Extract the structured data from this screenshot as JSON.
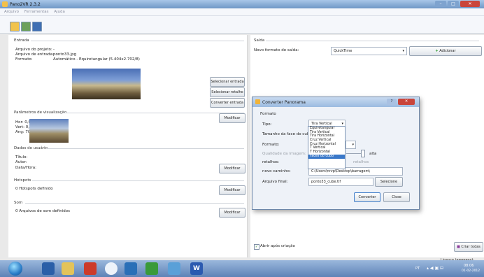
{
  "window": {
    "title": "Pano2VR 2.3.2"
  },
  "menu": [
    "Arquivo",
    "Ferramentas",
    "Ajuda"
  ],
  "left": {
    "entrada": {
      "title": "Entrada",
      "projeto_label": "Arquivo do projeto:",
      "projeto_value": "-",
      "entrada_label": "Arquivo de entrada:",
      "entrada_value": "ponto33.jpg",
      "formato_label": "Formato:",
      "formato_value": "Automático - Equiretangular (5.404x2.702/8)",
      "btn_selecionar_entrada": "Selecionar entrada",
      "btn_selecionar_retalho": "Selecionar retalho",
      "btn_converter_entrada": "Converter entrada"
    },
    "params": {
      "title": "Parâmetros de visualização",
      "hor": "Hor:  0,0",
      "vert": "Vert:  0,0",
      "ang": "Ang:  70,0",
      "btn_modificar": "Modificar"
    },
    "dados": {
      "title": "Dados do usuário",
      "titulo": "Título:",
      "autor": "Autor:",
      "data": "Data/Hora:",
      "btn_modificar": "Modificar"
    },
    "hotspots": {
      "title": "Hotspots",
      "info": "0 Hotspots definido",
      "btn_modificar": "Modificar"
    },
    "som": {
      "title": "Som",
      "info": "0 Arquivos de som definidos",
      "btn_modificar": "Modificar"
    }
  },
  "right": {
    "title": "Saída",
    "novo_formato_label": "Novo formato de saída:",
    "novo_formato_value": "QuickTime",
    "btn_adicionar": "Adicionar",
    "abrir_apos": "Abrir após criação",
    "btn_criar_todas": "Criar todas"
  },
  "dialog": {
    "title": "Converter Panorama",
    "group_formato": "Formato",
    "tipo_label": "Tipo:",
    "tipo_value": "Tira Vertical",
    "tamanho_label": "Tamanho da face do cubo:",
    "formato_label": "Formato:",
    "qualidade_label": "Qualidade da Imagem:",
    "qualidade_value": "alta",
    "retalhos_label": "retalhos:",
    "retalhos_hint": "retalhos",
    "novo_caminho_label": "novo caminho:",
    "novo_caminho_value": "C:\\Users\\nrvp\\Desktop\\barragem\\",
    "arquivo_final_label": "Arquivo final:",
    "arquivo_final_value": "ponto33_cube.tif",
    "btn_selecione": "Selecione",
    "btn_converter": "Converter",
    "btn_close": "Close",
    "options": [
      "Equiretangular",
      "Tira Vertical",
      "Tira Horizontal",
      "Cruz Vertical",
      "Cruz Horizontal",
      "T Vertical",
      "T Horizontal",
      "Faces do cubo"
    ],
    "selected_option": "Faces do cubo"
  },
  "status": {
    "licenca": "Licença (empresa):"
  },
  "taskbar": {
    "lang": "PT",
    "time": "08:06",
    "date": "01-02-2012"
  }
}
